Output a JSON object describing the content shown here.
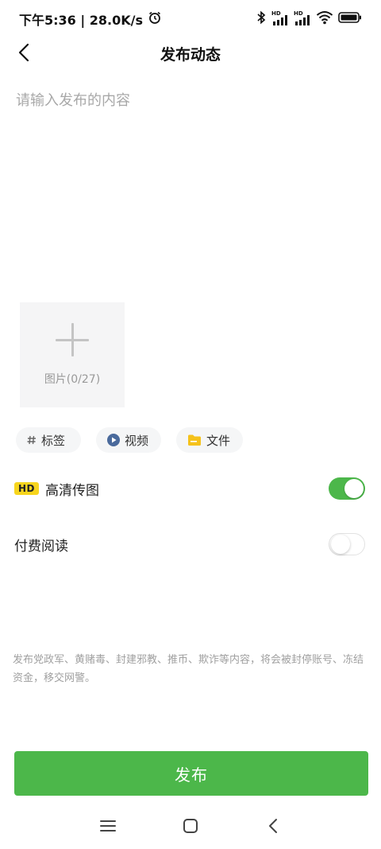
{
  "status_bar": {
    "time_speed": "下午5:36 | 28.0K/s",
    "icons": [
      "alarm-icon",
      "bluetooth-icon",
      "signal-hd-icon",
      "signal-hd-icon",
      "wifi-icon",
      "battery-icon"
    ],
    "signal_badges": [
      "HD",
      "HD"
    ]
  },
  "nav": {
    "title": "发布动态",
    "back_icon": "chevron-left-icon"
  },
  "editor": {
    "placeholder": "请输入发布的内容",
    "value": ""
  },
  "image_picker": {
    "label": "图片(0/27)",
    "icon": "plus-icon"
  },
  "chips": [
    {
      "label": "标签",
      "icon": "hash-icon"
    },
    {
      "label": "视频",
      "icon": "play-icon"
    },
    {
      "label": "文件",
      "icon": "folder-icon"
    }
  ],
  "settings": {
    "hd_badge": "HD",
    "hd_label": "高清传图",
    "hd_on": true,
    "paid_label": "付费阅读",
    "paid_on": false
  },
  "warning": "发布党政军、黄赌毒、封建邪教、推币、欺诈等内容，将会被封停账号、冻结资金，移交网警。",
  "publish_button": "发布",
  "colors": {
    "accent_green": "#4cb74a",
    "hd_badge_yellow": "#f7d51d",
    "folder_yellow": "#f5c21b",
    "play_blue": "#4a6a9c"
  },
  "system_nav": [
    "menu-icon",
    "home-icon",
    "back-icon"
  ]
}
